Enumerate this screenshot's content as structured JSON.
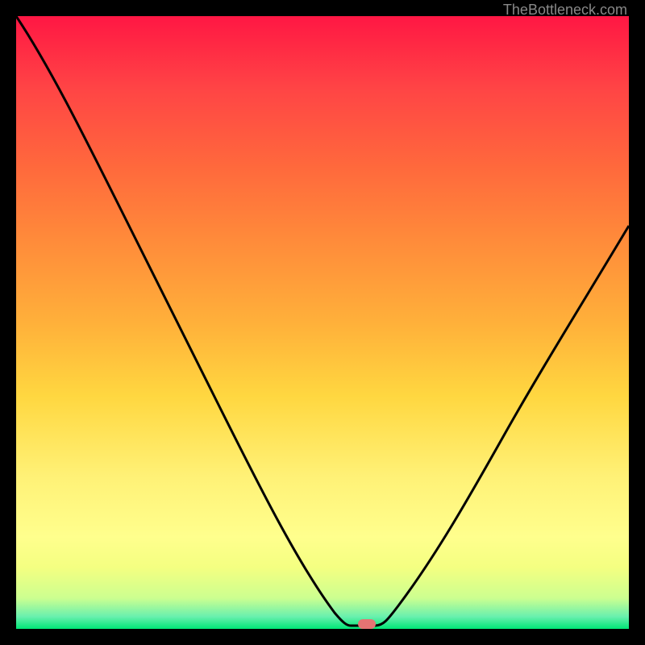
{
  "watermark": "TheBottleneck.com",
  "chart_data": {
    "type": "line",
    "title": "",
    "xlabel": "",
    "ylabel": "",
    "xlim": [
      0,
      100
    ],
    "ylim": [
      0,
      100
    ],
    "series": [
      {
        "name": "bottleneck-curve",
        "x": [
          0,
          8,
          16,
          24,
          30,
          36,
          42,
          48,
          52,
          54,
          56,
          58,
          62,
          68,
          74,
          80,
          86,
          92,
          100
        ],
        "y": [
          100,
          88,
          76,
          63,
          54,
          44,
          34,
          22,
          10,
          3,
          0,
          0,
          3,
          12,
          22,
          32,
          42,
          52,
          65
        ]
      }
    ],
    "marker": {
      "x": 57,
      "y": 0,
      "name": "optimal-point"
    },
    "gradient_stops": [
      {
        "pos": 0,
        "color": "#ff1744"
      },
      {
        "pos": 50,
        "color": "#ffd740"
      },
      {
        "pos": 100,
        "color": "#00e676"
      }
    ]
  }
}
